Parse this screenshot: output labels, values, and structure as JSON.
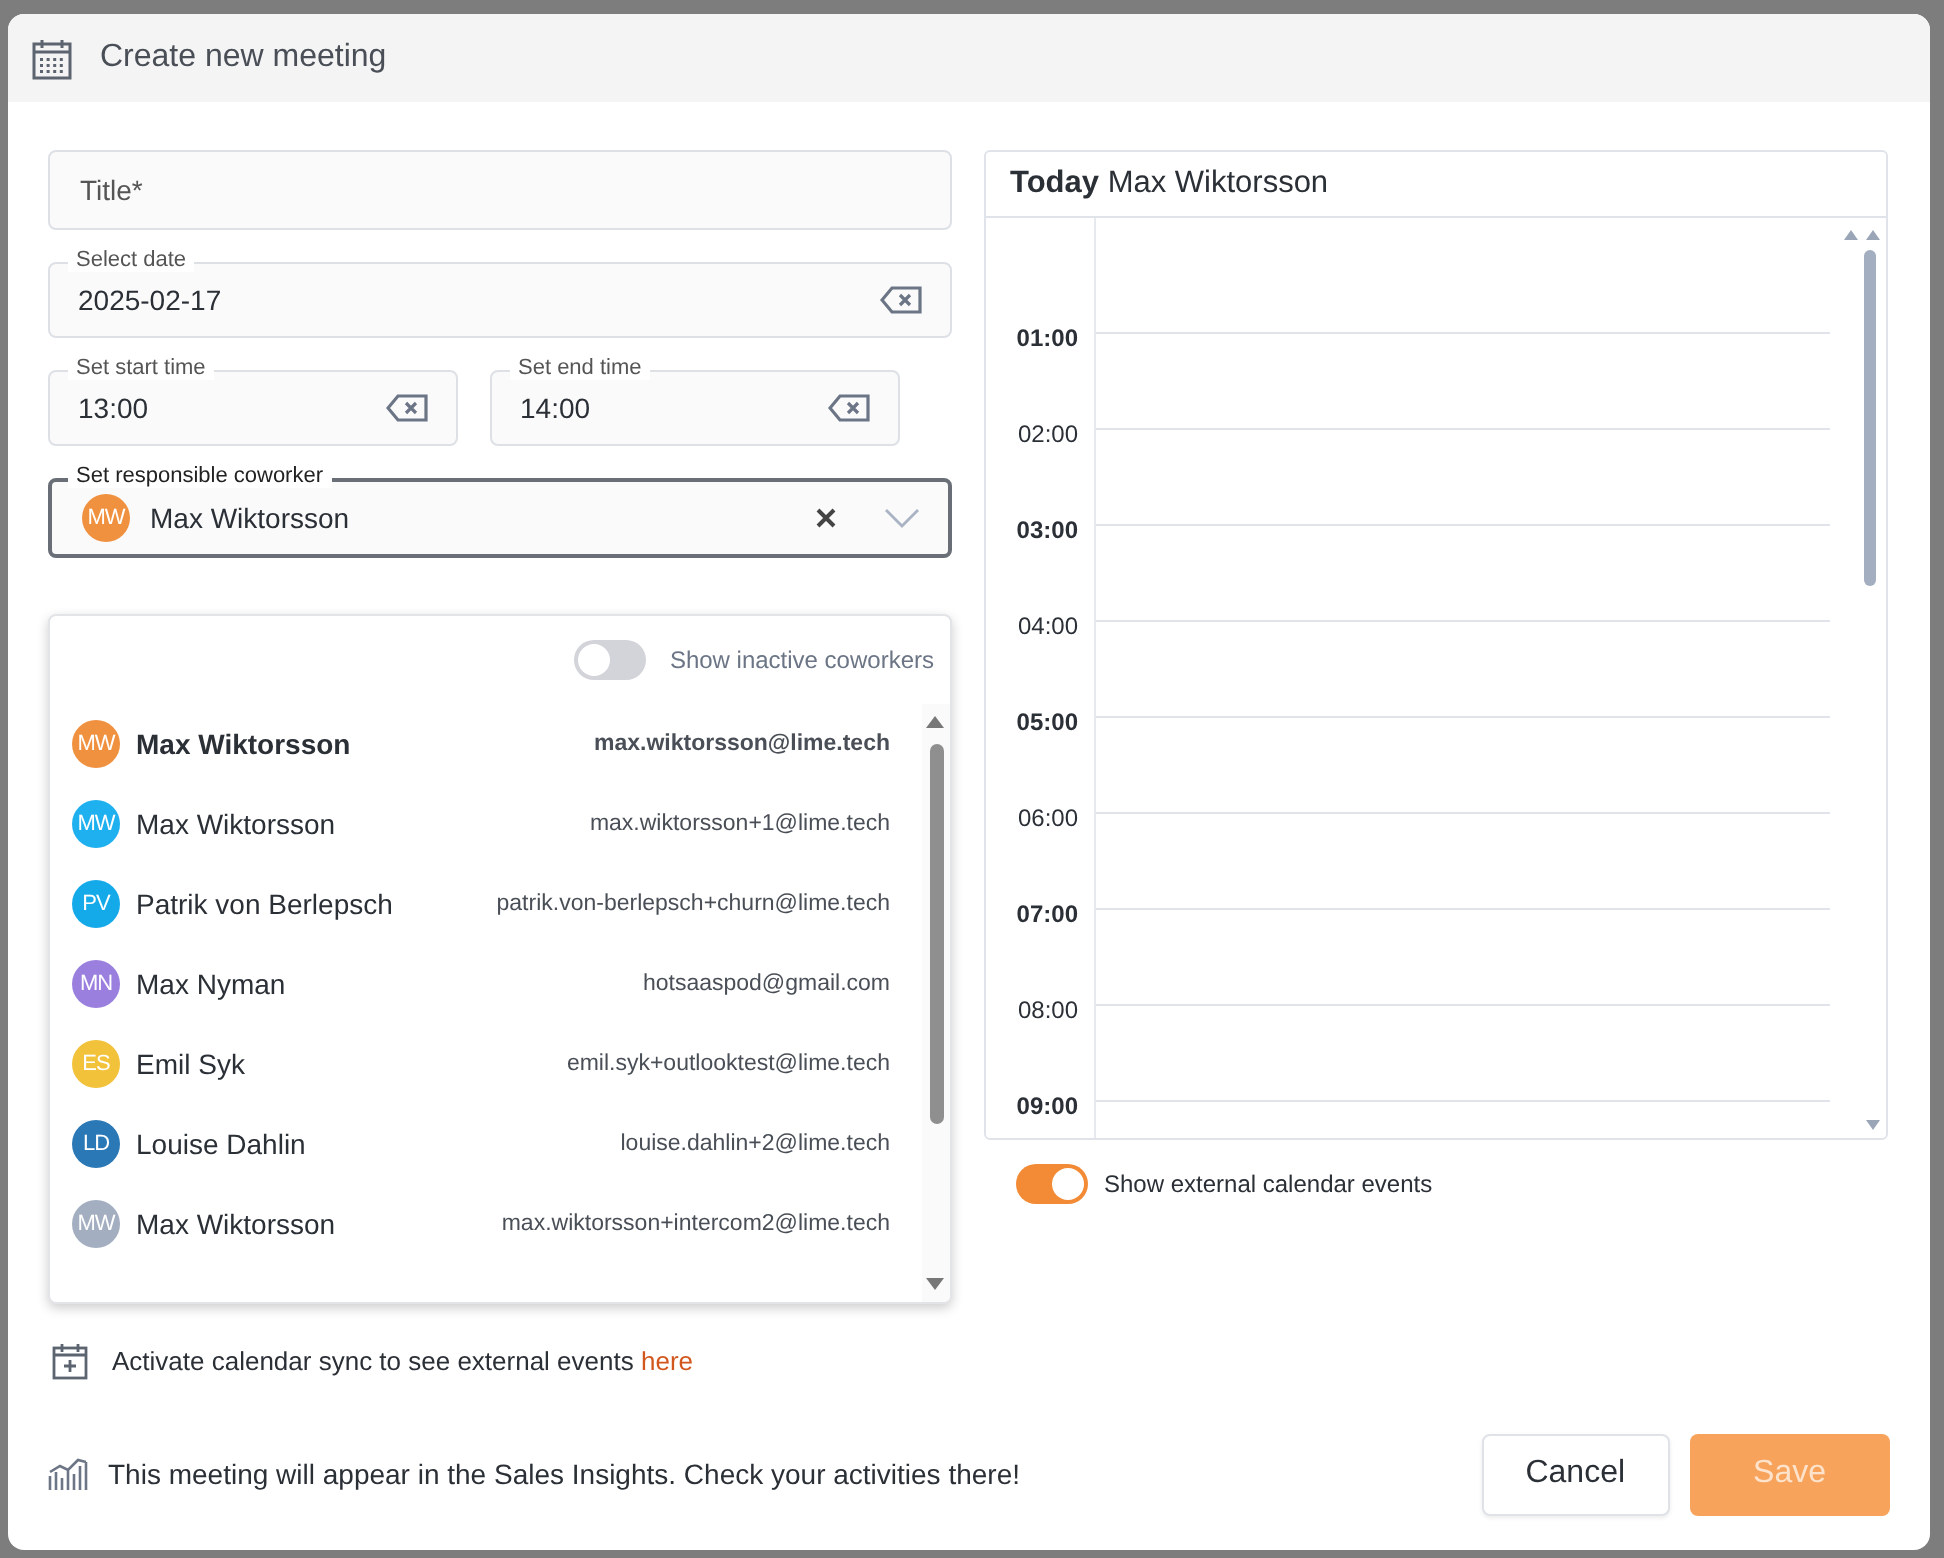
{
  "dialog": {
    "title": "Create new meeting"
  },
  "form": {
    "title_field": {
      "placeholder": "Title*"
    },
    "date_field": {
      "label": "Select date",
      "value": "2025-02-17"
    },
    "start_time": {
      "label": "Set start time",
      "value": "13:00"
    },
    "end_time": {
      "label": "Set end time",
      "value": "14:00"
    },
    "coworker_field": {
      "label": "Set responsible coworker",
      "initials": "MW",
      "color": "#f0913f",
      "value": "Max Wiktorsson",
      "expanded": true
    }
  },
  "coworker_menu": {
    "inactive_toggle": {
      "label": "Show inactive coworkers",
      "on": false
    },
    "items": [
      {
        "initials": "MW",
        "color": "#f0913f",
        "name": "Max Wiktorsson",
        "email": "max.wiktorsson@lime.tech",
        "selected": true
      },
      {
        "initials": "MW",
        "color": "#1eb0ef",
        "name": "Max Wiktorsson",
        "email": "max.wiktorsson+1@lime.tech",
        "selected": false
      },
      {
        "initials": "PV",
        "color": "#14aaea",
        "name": "Patrik von Berlepsch",
        "email": "patrik.von-berlepsch+churn@lime.tech",
        "selected": false
      },
      {
        "initials": "MN",
        "color": "#9a7fdf",
        "name": "Max Nyman",
        "email": "hotsaaspod@gmail.com",
        "selected": false
      },
      {
        "initials": "ES",
        "color": "#f2c23a",
        "name": "Emil Syk",
        "email": "emil.syk+outlooktest@lime.tech",
        "selected": false
      },
      {
        "initials": "LD",
        "color": "#2a78b6",
        "name": "Louise Dahlin",
        "email": "louise.dahlin+2@lime.tech",
        "selected": false
      },
      {
        "initials": "MW",
        "color": "#a3aec0",
        "name": "Max Wiktorsson",
        "email": "max.wiktorsson+intercom2@lime.tech",
        "selected": false
      }
    ]
  },
  "calendar": {
    "day": "Today",
    "owner": "Max Wiktorsson",
    "hours": [
      {
        "label": "01:00",
        "major": true
      },
      {
        "label": "02:00",
        "major": false
      },
      {
        "label": "03:00",
        "major": true
      },
      {
        "label": "04:00",
        "major": false
      },
      {
        "label": "05:00",
        "major": true
      },
      {
        "label": "06:00",
        "major": false
      },
      {
        "label": "07:00",
        "major": true
      },
      {
        "label": "08:00",
        "major": false
      },
      {
        "label": "09:00",
        "major": true
      }
    ],
    "external_toggle": {
      "label": "Show external calendar events",
      "on": true
    }
  },
  "sync_note": {
    "text": "Activate calendar sync to see external events",
    "link": "here"
  },
  "footer": {
    "note": "This meeting will appear in the Sales Insights. Check your activities there!",
    "buttons": [
      {
        "label": "Cancel",
        "kind": "secondary",
        "disabled": false
      },
      {
        "label": "Save",
        "kind": "primary",
        "disabled": true
      }
    ]
  }
}
